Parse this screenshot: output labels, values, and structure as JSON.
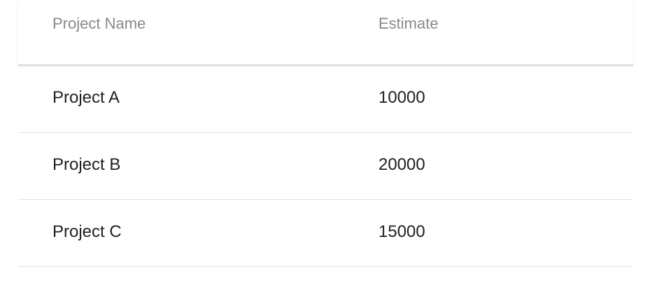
{
  "table": {
    "columns": [
      "Project Name",
      "Estimate"
    ],
    "rows": [
      {
        "name": "Project A",
        "estimate": "10000"
      },
      {
        "name": "Project B",
        "estimate": "20000"
      },
      {
        "name": "Project C",
        "estimate": "15000"
      }
    ]
  }
}
